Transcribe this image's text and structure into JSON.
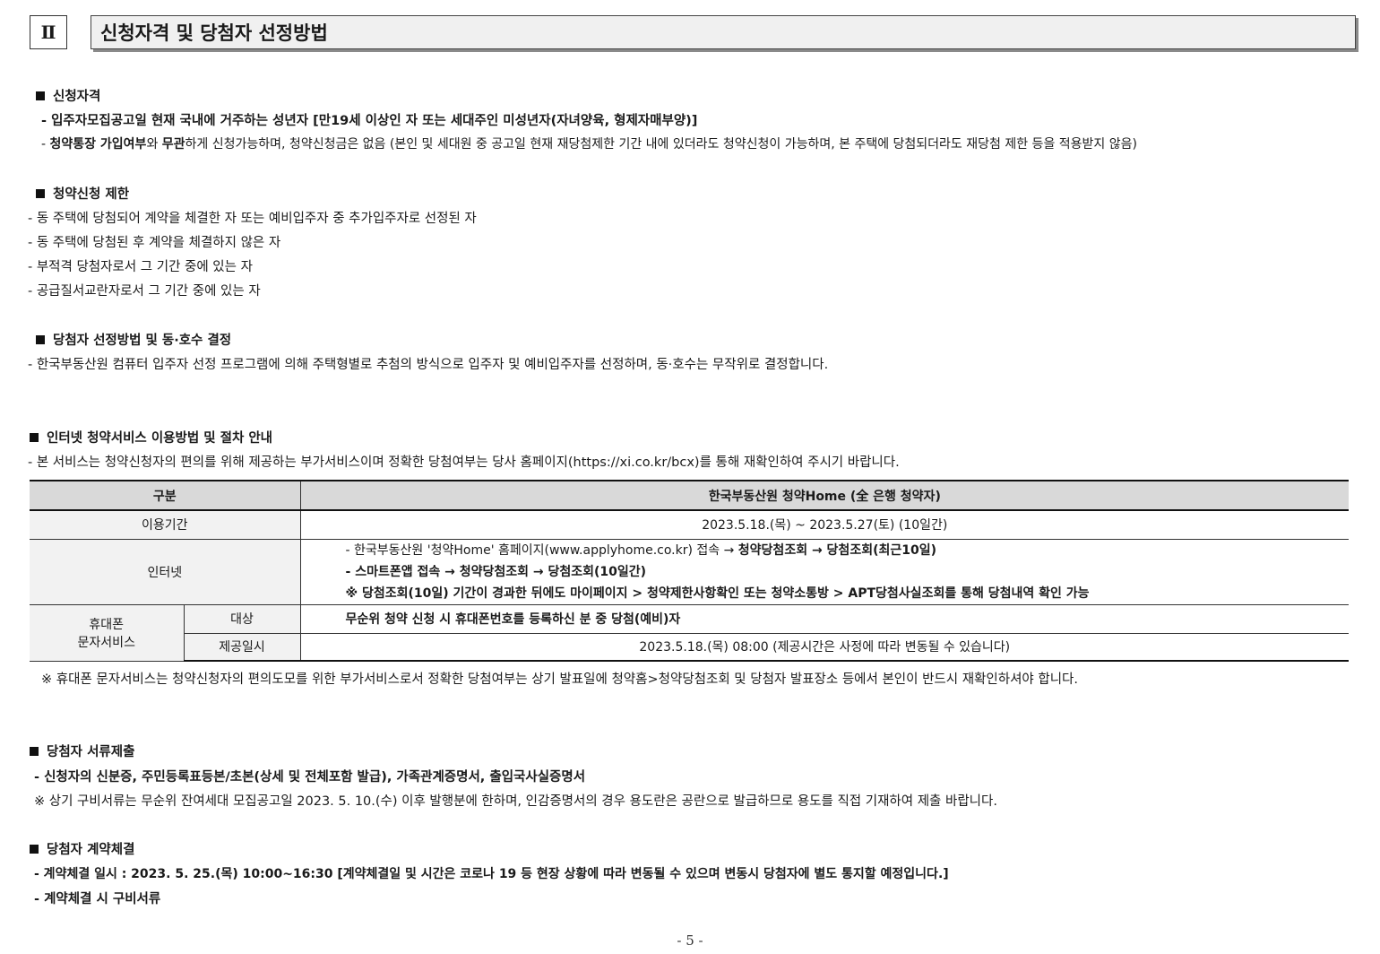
{
  "section": {
    "number": "Ⅱ",
    "title": "신청자격 및 당첨자 선정방법"
  },
  "eligibility": {
    "heading": "신청자격",
    "line1": "- 입주자모집공고일 현재 국내에 거주하는 성년자 [만19세 이상인 자 또는 세대주인 미성년자(자녀양육, 형제자매부양)]",
    "line2_prefix": "- ",
    "line2_bold1": "청약통장 가입여부",
    "line2_mid": "와 ",
    "line2_bold2": "무관",
    "line2_rest": "하게 신청가능하며, 청약신청금은 없음 (본인 및 세대원 중 공고일 현재 재당첨제한 기간 내에 있더라도 청약신청이 가능하며, 본 주택에 당첨되더라도 재당첨 제한 등을 적용받지 않음)"
  },
  "restriction": {
    "heading": "청약신청 제한",
    "items": [
      "- 동 주택에 당첨되어 계약을 체결한 자 또는 예비입주자 중 추가입주자로 선정된 자",
      "- 동 주택에 당첨된 후 계약을 체결하지 않은 자",
      "- 부적격 당첨자로서 그 기간 중에 있는 자",
      "- 공급질서교란자로서 그 기간 중에 있는 자"
    ]
  },
  "selection": {
    "heading": "당첨자 선정방법 및 동·호수 결정",
    "text": "- 한국부동산원 컴퓨터 입주자 선정 프로그램에 의해 주택형별로 추첨의 방식으로 입주자 및 예비입주자를 선정하며, 동·호수는 무작위로 결정합니다."
  },
  "internet": {
    "heading": "인터넷 청약서비스 이용방법 및 절차 안내",
    "text": "- 본 서비스는 청약신청자의 편의를 위해 제공하는 부가서비스이며 정확한 당첨여부는 당사 홈페이지(https://xi.co.kr/bcx)를 통해 재확인하여 주시기 바랍니다."
  },
  "table": {
    "header_col1": "구분",
    "header_col2": "한국부동산원 청약Home (全 은행 청약자)",
    "period_label": "이용기간",
    "period_value": "2023.5.18.(목) ~ 2023.5.27(토) (10일간)",
    "internet_label": "인터넷",
    "internet_line1_plain": "- 한국부동산원 '청약Home' 홈페이지(www.applyhome.co.kr) 접속 → ",
    "internet_line1_bold": "청약당첨조회 → 당첨조회(최근10일)",
    "internet_line2": "- 스마트폰앱 접속  → 청약당첨조회 → 당첨조회(10일간)",
    "internet_line3": "※ 당첨조회(10일) 기간이 경과한 뒤에도 마이페이지 > 청약제한사항확인 또는 청약소통방 > APT당첨사실조회를 통해 당첨내역 확인 가능",
    "sms_label_line1": "휴대폰",
    "sms_label_line2": "문자서비스",
    "target_label": "대상",
    "target_value": "무순위 청약 신청 시 휴대폰번호를 등록하신 분 중 당첨(예비)자",
    "time_label": "제공일시",
    "time_value": "2023.5.18.(목) 08:00 (제공시간은 사정에 따라 변동될 수 있습니다)"
  },
  "table_note": "※ 휴대폰 문자서비스는 청약신청자의 편의도모를 위한 부가서비스로서 정확한 당첨여부는 상기 발표일에 청약홈>청약당첨조회 및 당첨자 발표장소 등에서 본인이 반드시 재확인하셔야 합니다.",
  "documents": {
    "heading": "당첨자 서류제출",
    "line1": "- 신청자의 신분증, 주민등록표등본/초본(상세 및 전체포함 발급), 가족관계증명서, 출입국사실증명서",
    "note": "※ 상기 구비서류는 무순위 잔여세대 모집공고일 2023. 5. 10.(수) 이후 발행분에 한하며, 인감증명서의 경우 용도란은 공란으로 발급하므로 용도를 직접 기재하여 제출 바랍니다."
  },
  "contract": {
    "heading": "당첨자 계약체결",
    "line1": "- 계약체결 일시 : 2023. 5. 25.(목) 10:00~16:30 [계약체결일 및 시간은 코로나 19 등 현장 상황에 따라 변동될 수 있으며 변동시 당첨자에 별도 통지할 예정입니다.]",
    "line2": "- 계약체결 시 구비서류"
  },
  "page_number": "- 5 -"
}
